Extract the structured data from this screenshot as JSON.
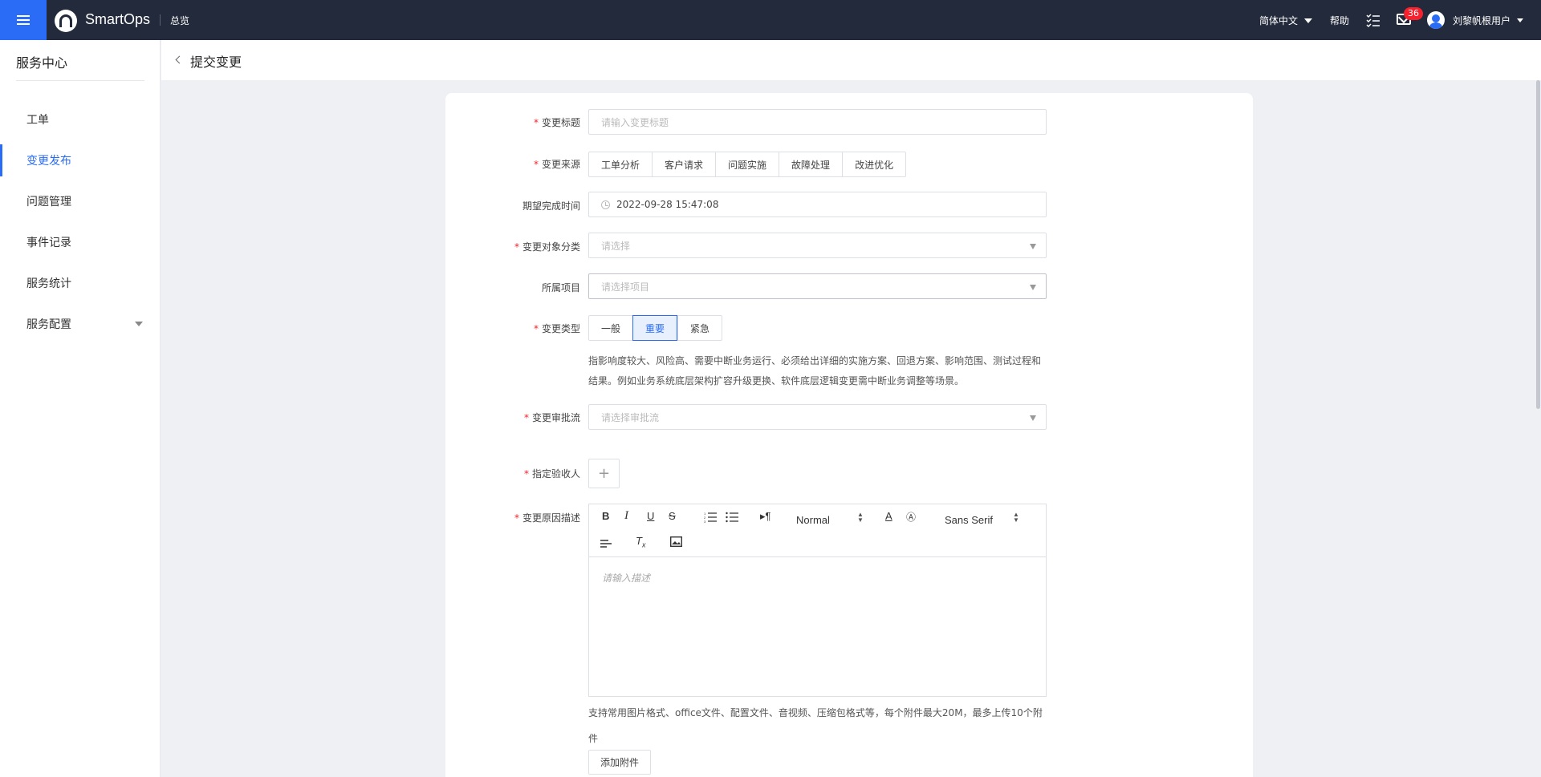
{
  "topbar": {
    "brand": "SmartOps",
    "overview": "总览",
    "language": "简体中文",
    "help": "帮助",
    "notification_count": "36",
    "username": "刘黎帆根用户"
  },
  "sidebar": {
    "title": "服务中心",
    "items": [
      {
        "label": "工单"
      },
      {
        "label": "变更发布"
      },
      {
        "label": "问题管理"
      },
      {
        "label": "事件记录"
      },
      {
        "label": "服务统计"
      },
      {
        "label": "服务配置"
      }
    ],
    "active_index": 1
  },
  "page": {
    "title": "提交变更"
  },
  "form": {
    "change_title": {
      "label": "变更标题",
      "placeholder": "请输入变更标题"
    },
    "change_source": {
      "label": "变更来源",
      "options": [
        "工单分析",
        "客户请求",
        "问题实施",
        "故障处理",
        "改进优化"
      ]
    },
    "expected_time": {
      "label": "期望完成时间",
      "value": "2022-09-28 15:47:08"
    },
    "object_category": {
      "label": "变更对象分类",
      "placeholder": "请选择"
    },
    "project": {
      "label": "所属项目",
      "placeholder": "请选择项目"
    },
    "change_type": {
      "label": "变更类型",
      "options": [
        "一般",
        "重要",
        "紧急"
      ],
      "selected": "重要",
      "description": "指影响度较大、风险高、需要中断业务运行、必须给出详细的实施方案、回退方案、影响范围、测试过程和结果。例如业务系统底层架构扩容升级更换、软件底层逻辑变更需中断业务调整等场景。"
    },
    "approval_flow": {
      "label": "变更审批流",
      "placeholder": "请选择审批流"
    },
    "acceptor": {
      "label": "指定验收人",
      "add": "+"
    },
    "reason": {
      "label": "变更原因描述",
      "placeholder": "请输入描述",
      "toolbar": {
        "heading": "Normal",
        "font": "Sans Serif"
      }
    },
    "attachment_hint": "支持常用图片格式、office文件、配置文件、音视频、压缩包格式等，每个附件最大20M，最多上传10个附件",
    "attachment_button": "添加附件"
  },
  "colors": {
    "topbar": "#232a3b",
    "accent": "#2a6cf6",
    "required": "#f5222d",
    "badge": "#f5222d"
  }
}
